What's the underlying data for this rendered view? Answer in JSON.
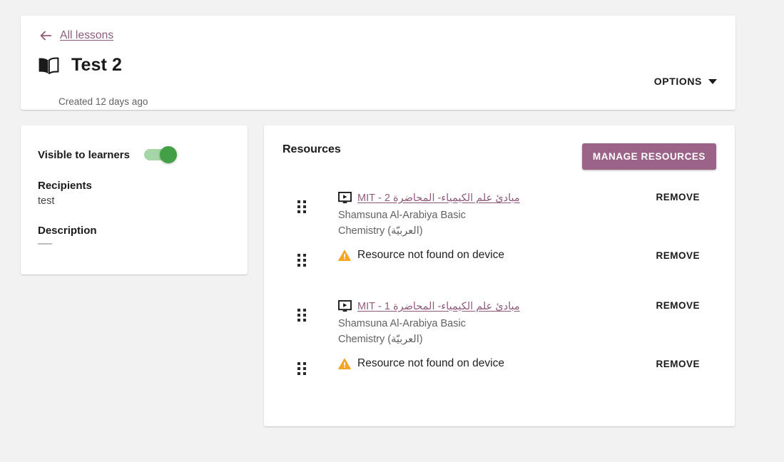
{
  "header": {
    "back_label": "All lessons",
    "title": "Test 2",
    "created": "Created 12 days ago",
    "options_label": "OPTIONS",
    "book_icon": "open-book-icon",
    "back_icon": "arrow-left-icon",
    "caret_icon": "chevron-down-icon"
  },
  "info": {
    "visible_label": "Visible to learners",
    "visible_on": true,
    "recipients_label": "Recipients",
    "recipients_value": "test",
    "description_label": "Description",
    "description_value": "—"
  },
  "resources": {
    "title": "Resources",
    "manage_label": "MANAGE RESOURCES",
    "remove_label": "REMOVE",
    "items": [
      {
        "type": "video",
        "icon": "video-icon",
        "title": "مبادئ علم الكيمياء- المحاضرة 2 - MIT",
        "subtitle": "Shamsuna Al-Arabiya Basic Chemistry (العربيّة)",
        "remove_label": "REMOVE"
      },
      {
        "type": "missing",
        "icon": "warning-triangle-icon",
        "title": "Resource not found on device",
        "remove_label": "REMOVE"
      },
      {
        "type": "video",
        "icon": "video-icon",
        "title": "مبادئ علم الكيمياء- المحاضرة 1 - MIT",
        "subtitle": "Shamsuna Al-Arabiya Basic Chemistry (العربيّة)",
        "remove_label": "REMOVE"
      },
      {
        "type": "missing",
        "icon": "warning-triangle-icon",
        "title": "Resource not found on device",
        "remove_label": "REMOVE"
      }
    ]
  },
  "colors": {
    "accent": "#9a6387",
    "link": "#8e5a7c",
    "toggle_on": "#43a047",
    "warning": "#f5a623",
    "page_bg": "#f2f2f2"
  }
}
